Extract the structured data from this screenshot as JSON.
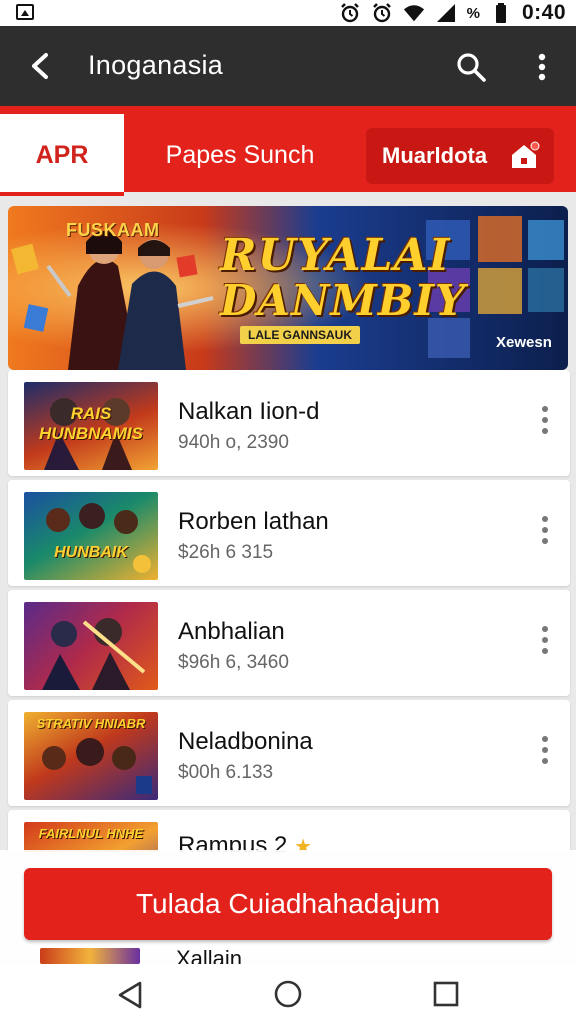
{
  "status_bar": {
    "battery_text": "%",
    "time": "0:40"
  },
  "app_bar": {
    "title": "Inoganasia",
    "icons": [
      "back-arrow-icon",
      "search-icon",
      "more-vert-icon"
    ]
  },
  "tabs": [
    {
      "label": "APR",
      "selected": true
    },
    {
      "label": "Papes Sunch",
      "selected": false
    },
    {
      "label": "Muarldota",
      "selected": false,
      "style": "pill",
      "icon": "home-badge-icon"
    }
  ],
  "banner": {
    "brand": "FUSKAAM",
    "title_line1": "RUYALAI",
    "title_line2": "DANMBIY",
    "subtitle": "LALE GANNSAUK",
    "logo": "Xewesn"
  },
  "items": [
    {
      "title": "Nalkan Iion‑d",
      "subtitle": "940h o, 2390",
      "thumb_text": "RAIS\nHUNBNAMIS"
    },
    {
      "title": "Rorben lathan",
      "subtitle": "$26h 6 315",
      "thumb_text": "HUNBAIK"
    },
    {
      "title": "Anbhalian",
      "subtitle": "$96h 6, 3460",
      "thumb_text": ""
    },
    {
      "title": "Neladbonina",
      "subtitle": "$00h 6.133",
      "thumb_text": "STRATIV HNIABR"
    },
    {
      "title": "Rampus 2",
      "subtitle": "",
      "thumb_text": "FAIRLNUL HNHE"
    }
  ],
  "action_button": {
    "label": "Tulada Cuiadhahadajum"
  },
  "peek_item": {
    "title": "Xallain"
  },
  "colors": {
    "accent": "#e3221c",
    "app_bar": "#2e2e2e",
    "background": "#e9e9e9"
  }
}
